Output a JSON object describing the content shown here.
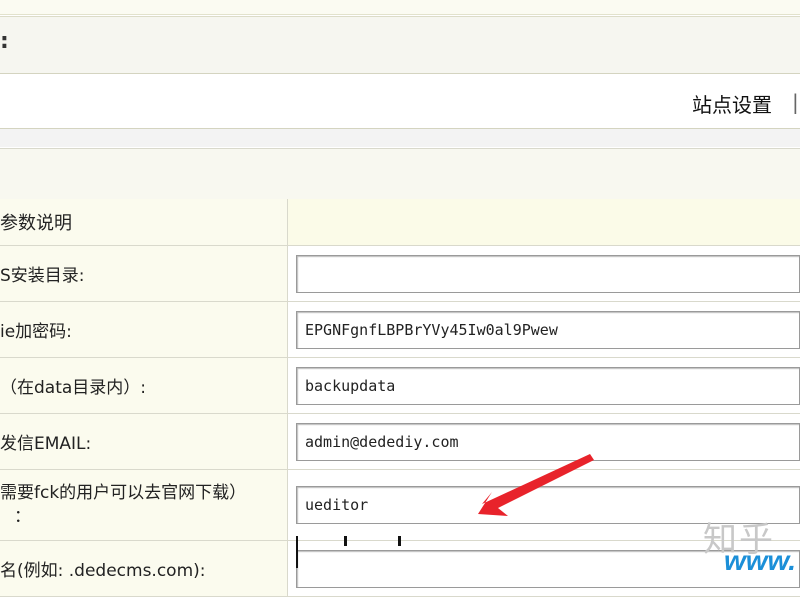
{
  "breadcrumb": {
    "tail": ":"
  },
  "tabs": {
    "site_settings": "站点设置",
    "separator": "|"
  },
  "table": {
    "header": {
      "label": "参数说明",
      "value": ""
    },
    "rows": [
      {
        "label": "S安装目录:",
        "value": ""
      },
      {
        "label": "ie加密码:",
        "value": "EPGNFgnfLBPBrYVy45Iw0al9Pwew"
      },
      {
        "label": "（在data目录内）:",
        "value": "backupdata"
      },
      {
        "label": "发信EMAIL:",
        "value": "admin@dedediy.com"
      },
      {
        "label_line1": "需要fck的用户可以去官网下载）",
        "label_line2": "：",
        "value": "ueditor"
      },
      {
        "label": "名(例如: .dedecms.com):",
        "value": ""
      }
    ]
  },
  "watermark": {
    "cn": "知乎",
    "www": "www."
  },
  "colors": {
    "arrow": "#e8232b",
    "label_bg": "#fbfbee",
    "border": "#d9d9cc"
  }
}
